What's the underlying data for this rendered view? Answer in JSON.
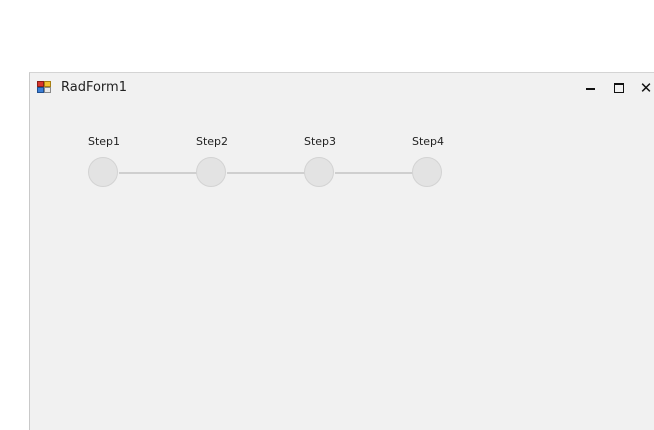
{
  "window": {
    "title": "RadForm1",
    "controls": {
      "minimize_icon": "minimize-icon",
      "maximize_icon": "maximize-icon",
      "close_icon": "close-icon",
      "close_glyph": "✕"
    }
  },
  "stepper": {
    "steps": [
      {
        "label": "Step1"
      },
      {
        "label": "Step2"
      },
      {
        "label": "Step3"
      },
      {
        "label": "Step4"
      }
    ]
  }
}
